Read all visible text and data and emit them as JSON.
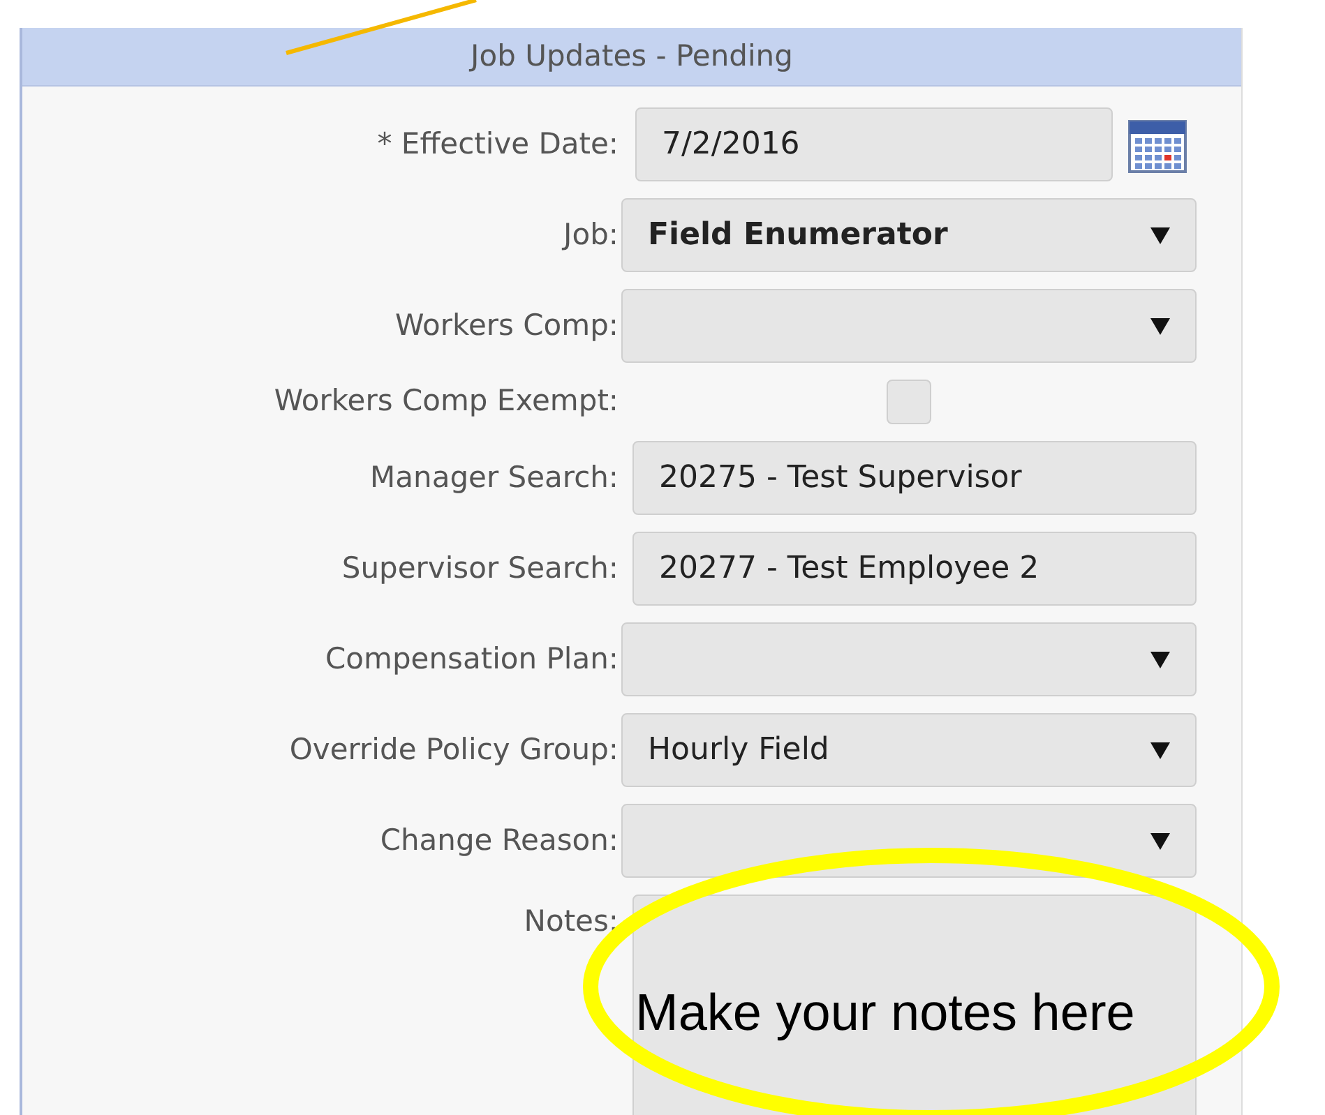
{
  "header": {
    "title": "Job Updates - Pending"
  },
  "fields": [
    {
      "kind": "date",
      "label": "* Effective Date:",
      "value": "7/2/2016"
    },
    {
      "kind": "select",
      "label": "Job:",
      "value": "Field Enumerator",
      "bold": true
    },
    {
      "kind": "select",
      "label": "Workers Comp:"
    },
    {
      "kind": "checkbox",
      "label": "Workers Comp Exempt:",
      "checked": false
    },
    {
      "kind": "text",
      "label": "Manager Search:",
      "value": "20275 - Test Supervisor"
    },
    {
      "kind": "text",
      "label": "Supervisor Search:",
      "value": "20277 - Test Employee 2"
    },
    {
      "kind": "select",
      "label": "Compensation Plan:"
    },
    {
      "kind": "select",
      "label": "Override Policy Group:",
      "value": "Hourly Field",
      "bold": false
    },
    {
      "kind": "select",
      "label": "Change Reason:"
    },
    {
      "kind": "textarea",
      "label": "Notes:"
    }
  ],
  "annotation": {
    "text": "Make your notes here"
  }
}
